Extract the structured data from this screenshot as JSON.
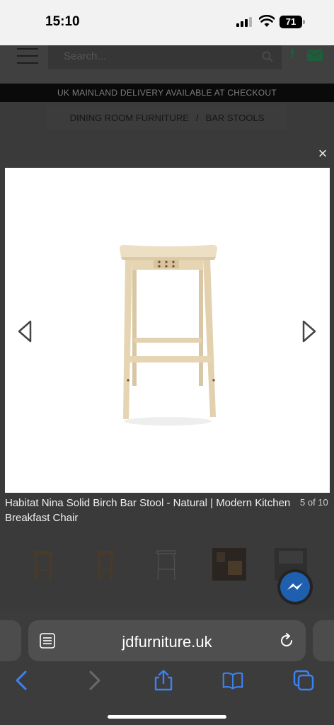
{
  "status_bar": {
    "time": "15:10",
    "battery": "71"
  },
  "header": {
    "search_placeholder": "Search..."
  },
  "delivery_banner": "UK MAINLAND DELIVERY AVAILABLE AT CHECKOUT",
  "breadcrumb": {
    "items": [
      "DINING ROOM FURNITURE",
      "BAR STOOLS"
    ],
    "separator": "/"
  },
  "lightbox": {
    "close_label": "×",
    "caption": "Habitat Nina Solid Birch Bar Stool - Natural | Modern Kitchen Breakfast Chair",
    "counter": "5 of 10"
  },
  "browser": {
    "url": "jdfurniture.uk"
  },
  "colors": {
    "accent_blue": "#3b82f6",
    "brand_green": "#1c5f3a",
    "wood": "#e3d2b0"
  },
  "icons": [
    "menu-icon",
    "search-icon",
    "facebook-icon",
    "mail-icon",
    "close-icon",
    "arrow-left-icon",
    "arrow-right-icon",
    "messenger-icon",
    "reader-icon",
    "reload-icon",
    "back-icon",
    "forward-icon",
    "share-icon",
    "bookmarks-icon",
    "tabs-icon"
  ]
}
